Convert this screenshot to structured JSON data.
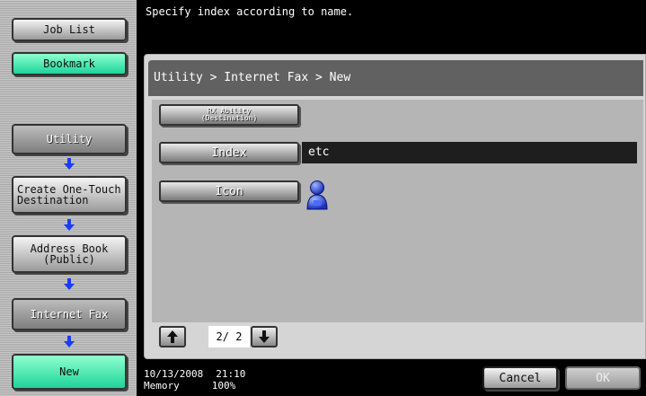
{
  "left_panel": {
    "job_list": "Job List",
    "bookmark": "Bookmark",
    "utility": "Utility",
    "create_one_touch": "Create One-Touch\nDestination",
    "address_book": "Address Book\n(Public)",
    "internet_fax": "Internet Fax",
    "new": "New"
  },
  "header": {
    "message": "Specify index according to name."
  },
  "breadcrumb": "Utility > Internet Fax > New",
  "form": {
    "rx_ability_label": "RX Ability\n(Destination)",
    "index_label": "Index",
    "index_value": "etc",
    "icon_label": "Icon"
  },
  "pager": {
    "text": "2/ 2"
  },
  "footer": {
    "date": "10/13/2008",
    "time": "21:10",
    "memory_label": "Memory",
    "memory_value": "100%",
    "cancel": "Cancel",
    "ok": "OK"
  },
  "colors": {
    "green_button": "#1ed49a",
    "arrow_blue": "#1a3cff",
    "breadcrumb_bar": "#616161"
  }
}
